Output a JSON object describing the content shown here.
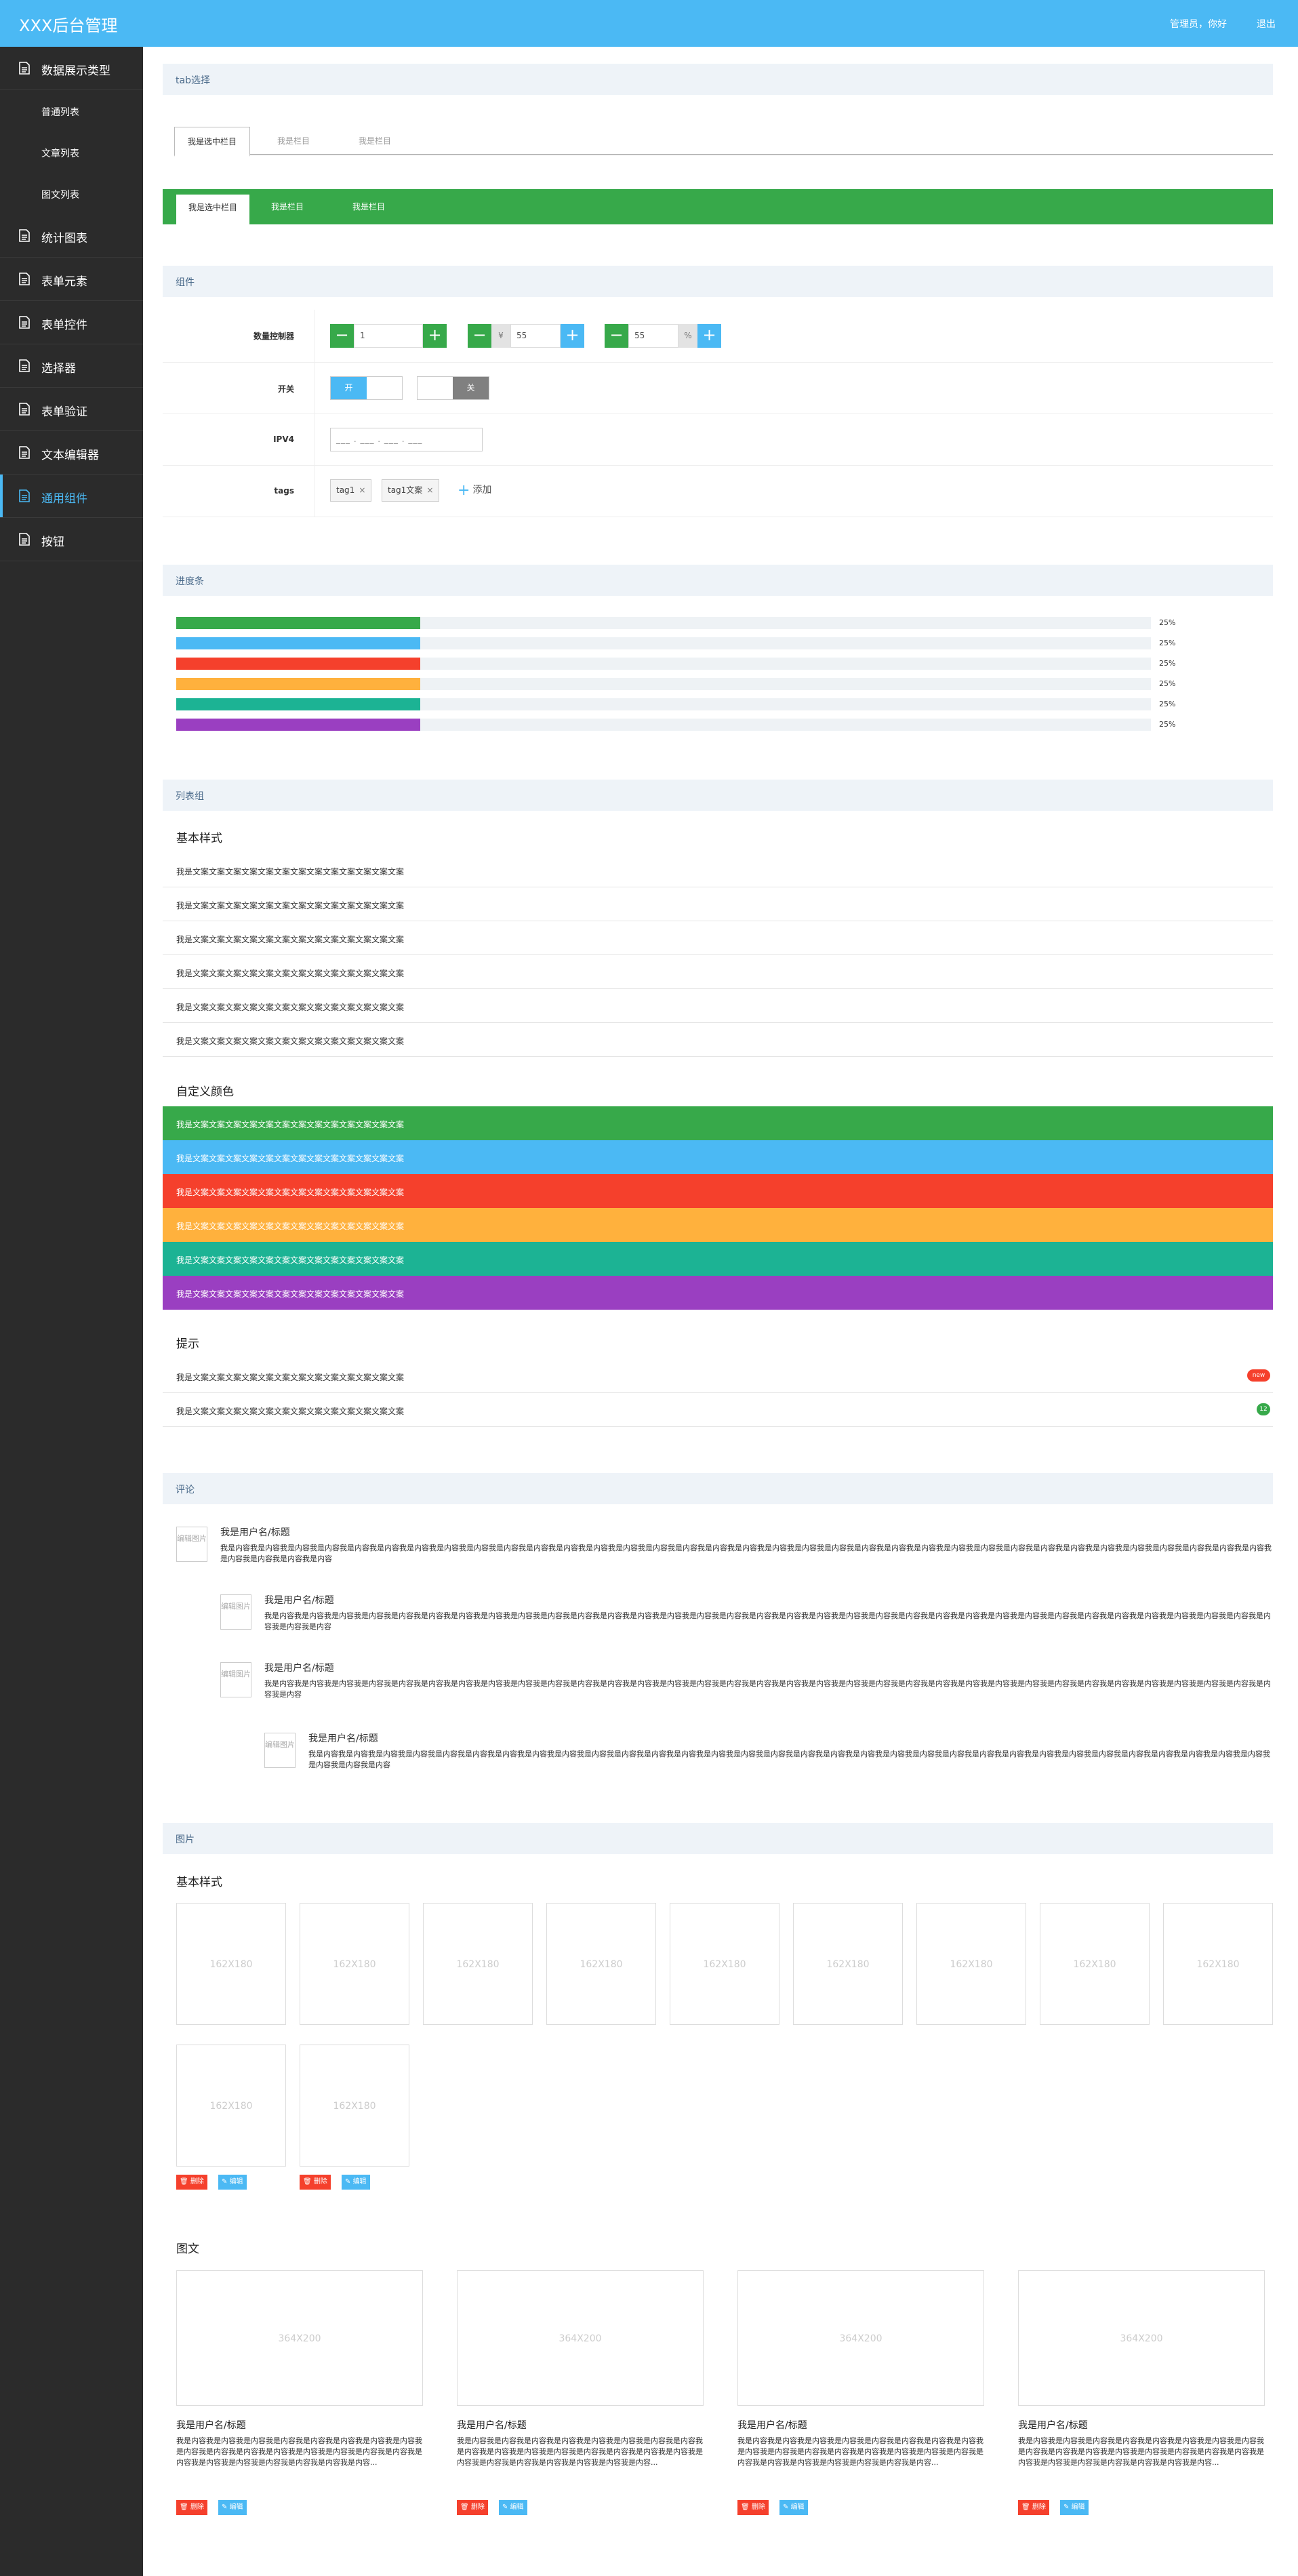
{
  "header": {
    "title": "XXX后台管理",
    "greeting": "管理员，你好",
    "logout": "退出"
  },
  "sidebar": {
    "items": [
      {
        "label": "数据展示类型"
      },
      {
        "label": "普通列表"
      },
      {
        "label": "文章列表"
      },
      {
        "label": "图文列表"
      },
      {
        "label": "统计图表"
      },
      {
        "label": "表单元素"
      },
      {
        "label": "表单控件"
      },
      {
        "label": "选择器"
      },
      {
        "label": "表单验证"
      },
      {
        "label": "文本编辑器"
      },
      {
        "label": "通用组件"
      },
      {
        "label": "按钮"
      }
    ]
  },
  "colors": {
    "brand_blue": "#4bb9f4",
    "green": "#37a94a",
    "red": "#f5402c",
    "orange": "#ffb13d",
    "teal": "#1cb394",
    "purple": "#9a3fc1"
  },
  "tabs": {
    "title": "tab选择",
    "outline": [
      "我是选中栏目",
      "我是栏目",
      "我是栏目"
    ],
    "green": [
      "我是选中栏目",
      "我是栏目",
      "我是栏目"
    ]
  },
  "widgets": {
    "title": "组件",
    "stepper_label": "数量控制器",
    "stepper1_value": "1",
    "stepper2_prefix": "¥",
    "stepper2_value": "55",
    "stepper3_value": "55",
    "stepper3_suffix": "%",
    "switch_label": "开关",
    "switch_on": "开",
    "switch_off": "关",
    "ipv4_label": "IPV4",
    "ipv4_value": "___ . ___ . ___ . ___",
    "tags_label": "tags",
    "tags": [
      "tag1",
      "tag1文案"
    ],
    "add_tag": "添加"
  },
  "progress": {
    "title": "进度条",
    "bars": [
      {
        "value": 25,
        "label": "25%",
        "color": "#37a94a"
      },
      {
        "value": 25,
        "label": "25%",
        "color": "#4bb9f4"
      },
      {
        "value": 25,
        "label": "25%",
        "color": "#f5402c"
      },
      {
        "value": 25,
        "label": "25%",
        "color": "#ffb13d"
      },
      {
        "value": 25,
        "label": "25%",
        "color": "#1cb394"
      },
      {
        "value": 25,
        "label": "25%",
        "color": "#9a3fc1"
      }
    ]
  },
  "lists": {
    "title": "列表组",
    "basic_title": "基本样式",
    "basic_items": [
      "我是文案文案文案文案文案文案文案文案文案文案文案文案文案",
      "我是文案文案文案文案文案文案文案文案文案文案文案文案文案",
      "我是文案文案文案文案文案文案文案文案文案文案文案文案文案",
      "我是文案文案文案文案文案文案文案文案文案文案文案文案文案",
      "我是文案文案文案文案文案文案文案文案文案文案文案文案文案",
      "我是文案文案文案文案文案文案文案文案文案文案文案文案文案"
    ],
    "color_title": "自定义颜色",
    "color_items": [
      "我是文案文案文案文案文案文案文案文案文案文案文案文案文案",
      "我是文案文案文案文案文案文案文案文案文案文案文案文案文案",
      "我是文案文案文案文案文案文案文案文案文案文案文案文案文案",
      "我是文案文案文案文案文案文案文案文案文案文案文案文案文案",
      "我是文案文案文案文案文案文案文案文案文案文案文案文案文案",
      "我是文案文案文案文案文案文案文案文案文案文案文案文案文案"
    ],
    "tip_title": "提示",
    "tip_items": [
      {
        "text": "我是文案文案文案文案文案文案文案文案文案文案文案文案文案",
        "badge": "new"
      },
      {
        "text": "我是文案文案文案文案文案文案文案文案文案文案文案文案文案",
        "badge": "12"
      }
    ]
  },
  "comments": {
    "title": "评论",
    "avatar_text": "编辑图片",
    "items": [
      {
        "name": "我是用户名/标题",
        "body": "我是内容我是内容我是内容我是内容我是内容我是内容我是内容我是内容我是内容我是内容我是内容我是内容我是内容我是内容我是内容我是内容我是内容我是内容我是内容我是内容我是内容我是内容我是内容我是内容我是内容我是内容我是内容我是内容我是内容我是内容我是内容我是内容我是内容我是内容我是内容我是内容我是内容我是内容我是内容"
      },
      {
        "name": "我是用户名/标题",
        "body": "我是内容我是内容我是内容我是内容我是内容我是内容我是内容我是内容我是内容我是内容我是内容我是内容我是内容我是内容我是内容我是内容我是内容我是内容我是内容我是内容我是内容我是内容我是内容我是内容我是内容我是内容我是内容我是内容我是内容我是内容我是内容我是内容我是内容我是内容我是内容我是内容"
      },
      {
        "name": "我是用户名/标题",
        "body": "我是内容我是内容我是内容我是内容我是内容我是内容我是内容我是内容我是内容我是内容我是内容我是内容我是内容我是内容我是内容我是内容我是内容我是内容我是内容我是内容我是内容我是内容我是内容我是内容我是内容我是内容我是内容我是内容我是内容我是内容我是内容我是内容我是内容我是内容我是内容"
      },
      {
        "name": "我是用户名/标题",
        "body": "我是内容我是内容我是内容我是内容我是内容我是内容我是内容我是内容我是内容我是内容我是内容我是内容我是内容我是内容我是内容我是内容我是内容我是内容我是内容我是内容我是内容我是内容我是内容我是内容我是内容我是内容我是内容我是内容我是内容我是内容我是内容我是内容我是内容我是内容我是内容"
      }
    ]
  },
  "images": {
    "title": "图片",
    "basic_title": "基本样式",
    "thumb_label": "162X180",
    "delete": "删除",
    "edit": "编辑",
    "card_title": "图文",
    "card_img_label": "364X200",
    "cards": [
      {
        "name": "我是用户名/标题",
        "desc": "我是内容我是内容我是内容我是内容我是内容我是内容我是内容我是内容我是内容我是内容我是内容我是内容我是内容我是内容我是内容我是内容我是内容我是内容我是内容我是内容我是内容我是内容我是内容..."
      },
      {
        "name": "我是用户名/标题",
        "desc": "我是内容我是内容我是内容我是内容我是内容我是内容我是内容我是内容我是内容我是内容我是内容我是内容我是内容我是内容我是内容我是内容我是内容我是内容我是内容我是内容我是内容我是内容我是内容..."
      },
      {
        "name": "我是用户名/标题",
        "desc": "我是内容我是内容我是内容我是内容我是内容我是内容我是内容我是内容我是内容我是内容我是内容我是内容我是内容我是内容我是内容我是内容我是内容我是内容我是内容我是内容我是内容我是内容我是内容..."
      },
      {
        "name": "我是用户名/标题",
        "desc": "我是内容我是内容我是内容我是内容我是内容我是内容我是内容我是内容我是内容我是内容我是内容我是内容我是内容我是内容我是内容我是内容我是内容我是内容我是内容我是内容我是内容我是内容我是内容..."
      }
    ]
  }
}
